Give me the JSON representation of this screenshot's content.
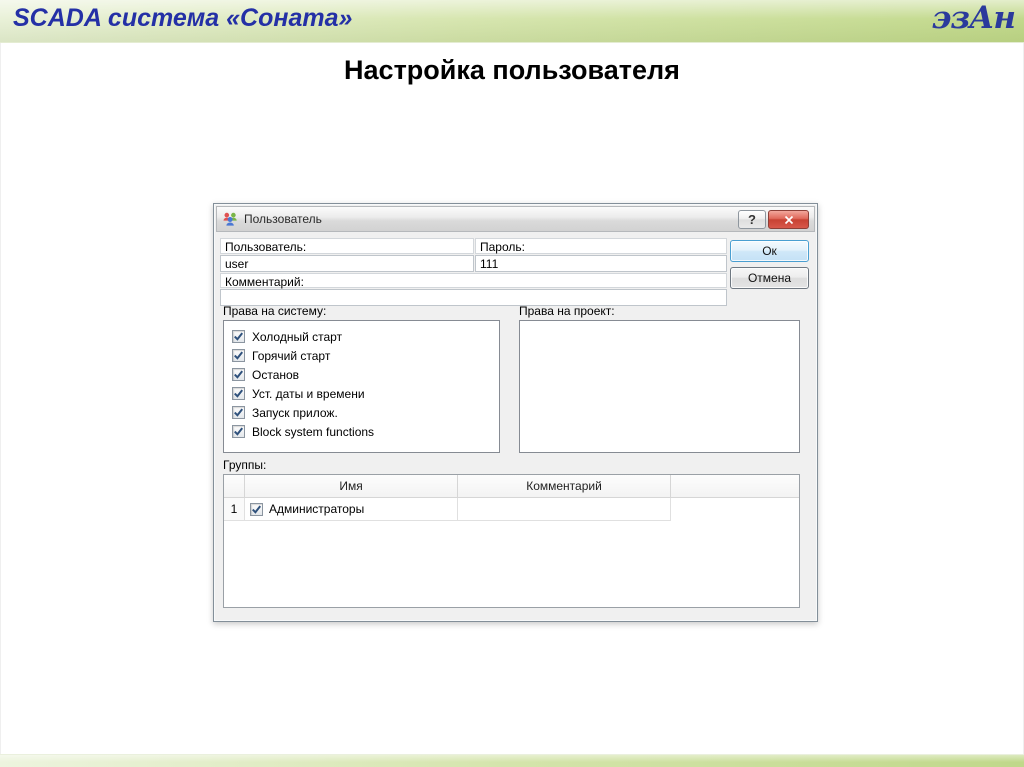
{
  "header": {
    "title": "SCADA система «Соната»",
    "logo": "эзАн"
  },
  "slide_title": "Настройка пользователя",
  "colors": {
    "header_green": "#d7e6b0",
    "header_title_blue": "#2430a6",
    "close_button_red": "#d8584a",
    "ok_border_blue": "#4a9fd1",
    "dialog_bg": "#f0f0f0"
  },
  "dialog": {
    "title": "Пользователь",
    "help_glyph": "?",
    "user_label": "Пользователь:",
    "user_value": "user",
    "password_label": "Пароль:",
    "password_value": "111",
    "comment_label": "Комментарий:",
    "comment_value": "",
    "ok_label": "Ок",
    "cancel_label": "Отмена",
    "system_rights": {
      "label": "Права на систему:",
      "items": [
        {
          "label": "Холодный старт",
          "checked": true
        },
        {
          "label": "Горячий старт",
          "checked": true
        },
        {
          "label": "Останов",
          "checked": true
        },
        {
          "label": "Уст. даты и времени",
          "checked": true
        },
        {
          "label": "Запуск прилож.",
          "checked": true
        },
        {
          "label": "Block system functions",
          "checked": true
        }
      ]
    },
    "project_rights": {
      "label": "Права на проект:",
      "items": []
    },
    "groups": {
      "label": "Группы:",
      "columns": [
        "Имя",
        "Комментарий"
      ],
      "rows": [
        {
          "num": "1",
          "checked": true,
          "name": "Администраторы",
          "comment": ""
        }
      ]
    }
  }
}
